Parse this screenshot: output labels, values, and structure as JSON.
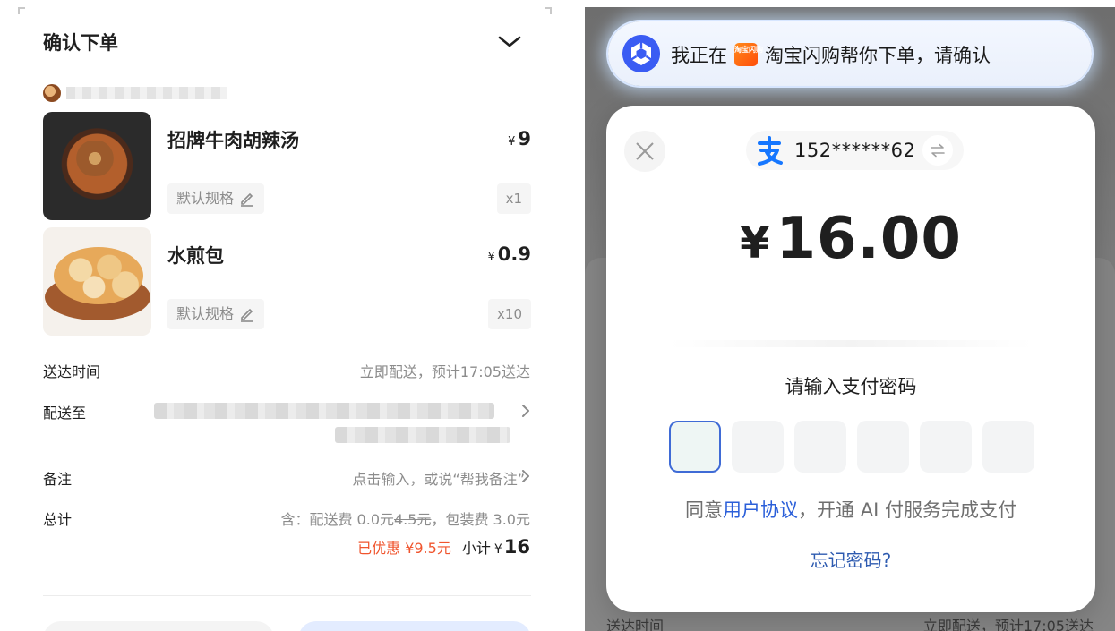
{
  "order": {
    "title": "确认下单",
    "items": [
      {
        "name": "招牌牛肉胡辣汤",
        "currency": "¥",
        "price": "9",
        "spec": "默认规格",
        "qty": "x1",
        "image": "beef-pepper-soup-photo"
      },
      {
        "name": "水煎包",
        "currency": "¥",
        "price": "0.9",
        "spec": "默认规格",
        "qty": "x10",
        "image": "pan-fried-buns-photo"
      }
    ],
    "delivery_time_label": "送达时间",
    "delivery_time_value": "立即配送，预计17:05送达",
    "deliver_to_label": "配送至",
    "remark_label": "备注",
    "remark_value": "点击输入，或说“帮我备注”",
    "total_label": "总计",
    "fee_prefix": "含：配送费",
    "fee_delivery": "0.0元",
    "fee_delivery_original": "4.5元",
    "fee_packaging": "，包装费 3.0元",
    "saved": "已优惠 ¥9.5元",
    "subtotal_label": "小计",
    "subtotal_currency": "¥",
    "subtotal_amount": "16"
  },
  "payment": {
    "banner_before": "我正在",
    "banner_app_badge": "淘宝闪购",
    "banner_after": "淘宝闪购帮你下单，请确认",
    "account": "152******62",
    "currency": "¥",
    "amount": "16.00",
    "password_title": "请输入支付密码",
    "agree_prefix": "同意",
    "agree_link": "用户协议",
    "agree_suffix": "，开通 AI 付服务完成支付",
    "forgot": "忘记密码?",
    "background_label": "送达时间",
    "background_value": "立即配送，预计17:05送达"
  },
  "colors": {
    "accent_blue": "#2b5fd9",
    "discount_red": "#f0552e",
    "alipay_blue": "#1677ff"
  },
  "icons": [
    "chevron-down-icon",
    "edit-pencil-icon",
    "chevron-right-icon",
    "close-icon",
    "alipay-icon",
    "switch-account-icon",
    "assistant-logo-icon"
  ]
}
